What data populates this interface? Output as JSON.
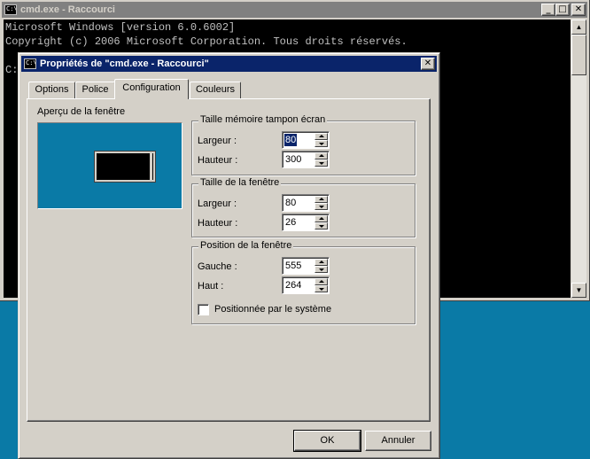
{
  "console_window": {
    "title": "cmd.exe - Raccourci",
    "icon": "C:\\",
    "buttons": {
      "minimize": "_",
      "maximize": "□",
      "close": "✕"
    },
    "lines": [
      "Microsoft Windows [version 6.0.6002]",
      "Copyright (c) 2006 Microsoft Corporation. Tous droits réservés.",
      "",
      "C:"
    ],
    "scroll_up": "▲",
    "scroll_down": "▼"
  },
  "dialog": {
    "title": "Propriétés de \"cmd.exe - Raccourci\"",
    "close": "✕",
    "tabs": [
      "Options",
      "Police",
      "Configuration",
      "Couleurs"
    ],
    "selected_tab": "Configuration",
    "preview_label": "Aperçu de la fenêtre",
    "buffer_group": {
      "title": "Taille mémoire tampon écran",
      "width_label": "Largeur :",
      "width_value": "80",
      "height_label": "Hauteur :",
      "height_value": "300"
    },
    "window_size_group": {
      "title": "Taille de la fenêtre",
      "width_label": "Largeur :",
      "width_value": "80",
      "height_label": "Hauteur :",
      "height_value": "26"
    },
    "position_group": {
      "title": "Position de la fenêtre",
      "left_label": "Gauche :",
      "left_value": "555",
      "top_label": "Haut :",
      "top_value": "264",
      "system_checkbox_label": "Positionnée par le système",
      "system_checkbox_checked": false
    },
    "ok_label": "OK",
    "cancel_label": "Annuler"
  },
  "colors": {
    "desktop": "#0a7aa6",
    "console_bg": "#000000",
    "active_titlebar": "#0a246a",
    "inactive_titlebar": "#808080"
  }
}
